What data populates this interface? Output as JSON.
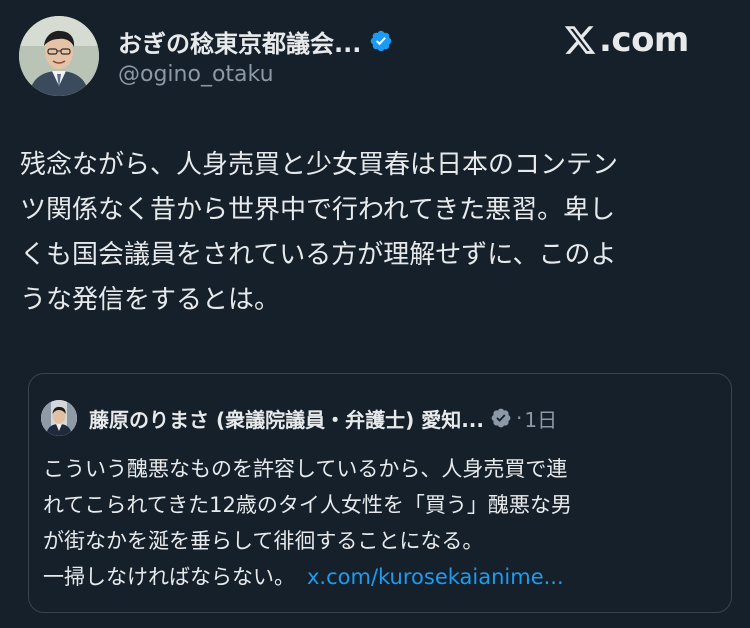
{
  "author": {
    "display_name": "おぎの稔東京都議会...",
    "handle": "@ogino_otaku",
    "verified": true
  },
  "site_label": ".com",
  "tweet": {
    "lines": [
      "残念ながら、人身売買と少女買春は日本のコンテン",
      "ツ関係なく昔から世界中で行われてきた悪習。卑し",
      "くも国会議員をされている方が理解せずに、このよ",
      "うな発信をするとは。"
    ]
  },
  "quote": {
    "author_name": "藤原のりまさ (衆議院議員・弁護士) 愛知...",
    "verified": true,
    "separator": "·",
    "time": "1日",
    "lines": [
      "こういう醜悪なものを許容しているから、人身売買で連",
      "れてこられてきた12歳のタイ人女性を「買う」醜悪な男",
      "が街なかを涎を垂らして徘徊することになる。",
      "一掃しなければならない。"
    ],
    "link": "x.com/kurosekaianime..."
  },
  "colors": {
    "background": "#15202b",
    "text_primary": "#e7e9ea",
    "text_secondary": "#8b98a5",
    "link": "#1d9bf0",
    "verified_badge": "#1d9bf0",
    "border": "#38444d"
  },
  "icons": {
    "verified": "verified-badge-icon",
    "brand": "x-logo-icon"
  }
}
